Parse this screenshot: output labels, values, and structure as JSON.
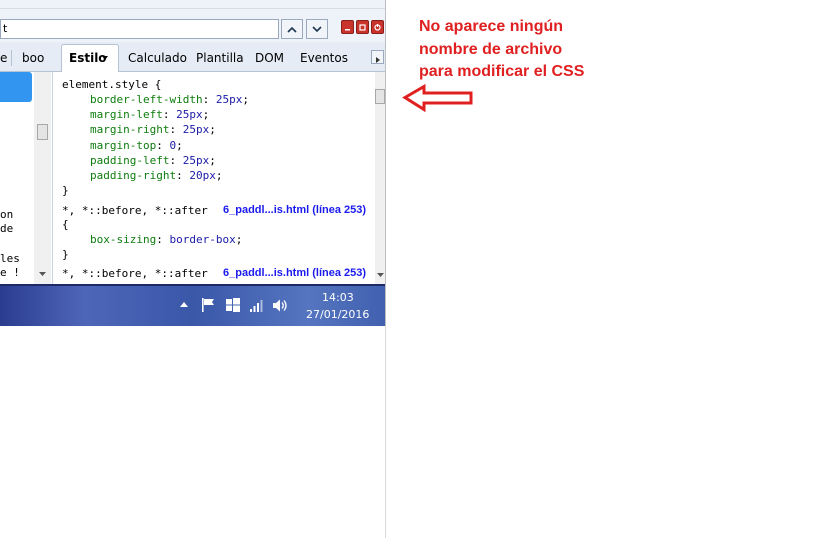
{
  "toolbar": {
    "search_value": "t",
    "icons": [
      "chevron-up-icon",
      "chevron-down-icon",
      "minimize-icon",
      "restore-icon",
      "close-icon"
    ]
  },
  "tabs": {
    "truncated": [
      "e",
      "boo"
    ],
    "active": "Estilo",
    "items": [
      "Calculado",
      "Plantilla",
      "DOM",
      "Eventos"
    ]
  },
  "left_panel": {
    "lines": [
      "on",
      "de",
      "",
      "les",
      "e !"
    ]
  },
  "css": {
    "rule1_selector": "element.style {",
    "rule1_props": [
      {
        "name": "border-left-width",
        "value": "25px"
      },
      {
        "name": "margin-left",
        "value": "25px"
      },
      {
        "name": "margin-right",
        "value": "25px"
      },
      {
        "name": "margin-top",
        "value": "0"
      },
      {
        "name": "padding-left",
        "value": "25px"
      },
      {
        "name": "padding-right",
        "value": "20px"
      }
    ],
    "close_brace": "}",
    "open_brace": "{",
    "rule2_selector": "*, *::before, *::after",
    "rule2_link": "6_paddl...is.html (línea 253)",
    "rule2_props": [
      {
        "name": "box-sizing",
        "value": "border-box"
      }
    ],
    "rule3_selector": "*, *::before, *::after",
    "rule3_link": "6_paddl...is.html (línea 253)"
  },
  "taskbar": {
    "time": "14:03",
    "date": "27/01/2016",
    "icons": [
      "show-hidden-icons-icon",
      "action-center-flag-icon",
      "windows-logo-icon",
      "network-signal-icon",
      "volume-icon"
    ]
  },
  "annotation": {
    "line1": "No aparece ningún",
    "line2": "nombre de archivo",
    "line3": "para modificar el CSS",
    "arrow_color": "#e02020"
  }
}
